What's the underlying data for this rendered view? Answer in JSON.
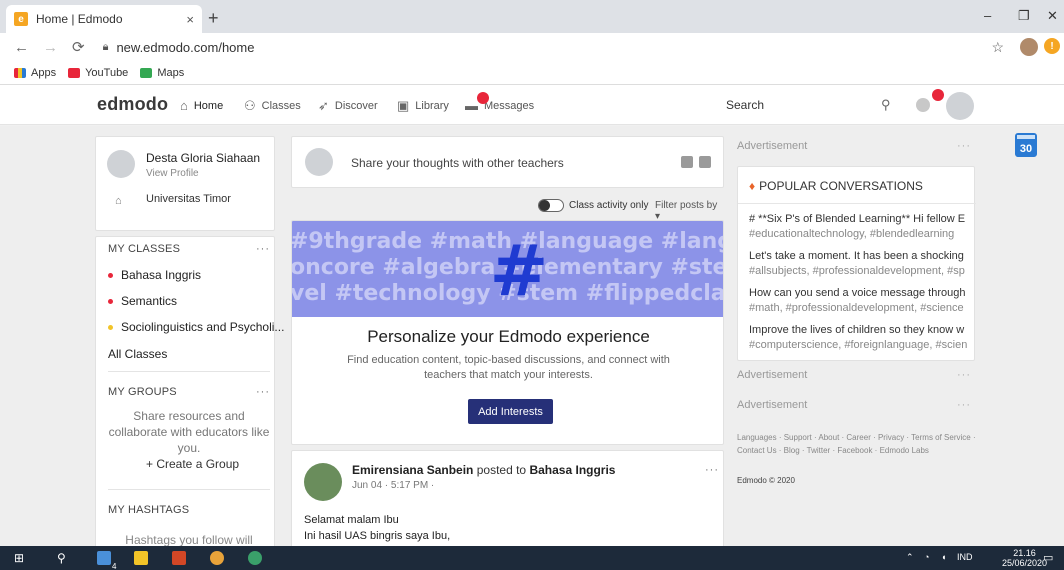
{
  "browser": {
    "tab_title": "Home | Edmodo",
    "tab_favicon_letter": "e",
    "tab_close": "×",
    "new_tab": "+",
    "url": "new.edmodo.com/home",
    "bookmarks": [
      "Apps",
      "YouTube",
      "Maps"
    ],
    "window_controls": {
      "minimize": "–",
      "restore": "❐",
      "close": "✕"
    }
  },
  "nav": {
    "logo": "edmodo",
    "items": [
      {
        "label": "Home",
        "icon": "home-icon"
      },
      {
        "label": "Classes",
        "icon": "classes-icon"
      },
      {
        "label": "Discover",
        "icon": "discover-icon"
      },
      {
        "label": "Library",
        "icon": "library-icon"
      },
      {
        "label": "Messages",
        "icon": "messages-icon"
      }
    ],
    "search_placeholder": "Search",
    "search_icon": "search-icon"
  },
  "profile": {
    "name": "Desta Gloria Siahaan",
    "view_profile": "View Profile",
    "school": "Universitas Timor"
  },
  "classes": {
    "title": "MY CLASSES",
    "items": [
      {
        "label": "Bahasa Inggris",
        "color": "#e8263a"
      },
      {
        "label": "Semantics",
        "color": "#e8263a"
      },
      {
        "label": "Sociolinguistics and Psycholi...",
        "color": "#f2c428"
      }
    ],
    "all_classes": "All Classes"
  },
  "groups": {
    "title": "MY GROUPS",
    "description": "Share resources and collaborate with educators like you.",
    "create_label": "+ Create a Group"
  },
  "hashtags": {
    "title": "MY HASHTAGS",
    "description": "Hashtags you follow will appear"
  },
  "share": {
    "placeholder": "Share your thoughts with other teachers"
  },
  "filter": {
    "class_activity": "Class activity only",
    "filter_posts": "Filter posts by ▾"
  },
  "banner": {
    "lines": [
      "#9thgrade #math #language #langu",
      "oncore #algebra #elementary #ste",
      "vel #technology #stem #flippedcla"
    ],
    "hash_glyph": "#",
    "title": "Personalize your Edmodo experience",
    "description": "Find education content, topic-based discussions, and connect with teachers that match your interests.",
    "button": "Add Interests"
  },
  "post": {
    "author": "Emirensiana Sanbein",
    "verb": "posted to",
    "target": "Bahasa Inggris",
    "meta": "Jun 04 · 5:17 PM ·",
    "body_line1": "Selamat malam Ibu",
    "body_line2": "Ini hasil UAS bingris saya Ibu,"
  },
  "right": {
    "ad_label": "Advertisement",
    "popular_title": "POPULAR CONVERSATIONS",
    "conversations": [
      {
        "title": "# **Six P's of Blended Learning** Hi fellow E",
        "tags": "#educationaltechnology, #blendedlearning"
      },
      {
        "title": "Let's take a moment. It has been a shocking",
        "tags": "#allsubjects, #professionaldevelopment, #sp"
      },
      {
        "title": "How can you send a voice message through",
        "tags": "#math, #professionaldevelopment, #science"
      },
      {
        "title": "Improve the lives of children so they know w",
        "tags": "#computerscience, #foreignlanguage, #scien"
      }
    ],
    "footer_links": "Languages · Support · About · Career · Privacy · Terms of Service · Contact Us · Blog · Twitter · Facebook · Edmodo Labs",
    "copyright": "Edmodo © 2020",
    "calendar_day": "30"
  },
  "taskbar": {
    "language": "IND",
    "time": "21.16",
    "date": "25/06/2020",
    "badge": "4"
  }
}
